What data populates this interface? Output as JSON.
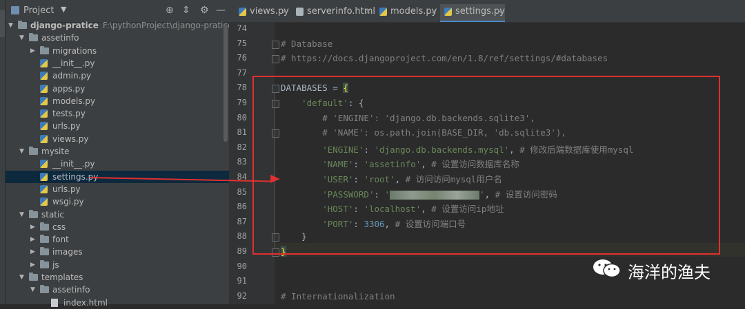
{
  "project_panel": {
    "title": "Project",
    "tree": [
      {
        "label": "django-pratice",
        "path": "F:\\pythonProject\\django-pratice",
        "kind": "folder",
        "level": 0,
        "open": true
      },
      {
        "label": "assetinfo",
        "kind": "folder",
        "level": 1,
        "open": true
      },
      {
        "label": "migrations",
        "kind": "folder",
        "level": 2,
        "open": false
      },
      {
        "label": "__init__.py",
        "kind": "py",
        "level": 2
      },
      {
        "label": "admin.py",
        "kind": "py",
        "level": 2
      },
      {
        "label": "apps.py",
        "kind": "py",
        "level": 2
      },
      {
        "label": "models.py",
        "kind": "py",
        "level": 2
      },
      {
        "label": "tests.py",
        "kind": "py",
        "level": 2
      },
      {
        "label": "urls.py",
        "kind": "py",
        "level": 2
      },
      {
        "label": "views.py",
        "kind": "py",
        "level": 2
      },
      {
        "label": "mysite",
        "kind": "folder",
        "level": 1,
        "open": true
      },
      {
        "label": "__init__.py",
        "kind": "py",
        "level": 2
      },
      {
        "label": "settings.py",
        "kind": "py",
        "level": 2,
        "selected": true
      },
      {
        "label": "urls.py",
        "kind": "py",
        "level": 2
      },
      {
        "label": "wsgi.py",
        "kind": "py",
        "level": 2
      },
      {
        "label": "static",
        "kind": "folder",
        "level": 1,
        "open": true
      },
      {
        "label": "css",
        "kind": "folder",
        "level": 2,
        "open": false
      },
      {
        "label": "font",
        "kind": "folder",
        "level": 2,
        "open": false
      },
      {
        "label": "images",
        "kind": "folder",
        "level": 2,
        "open": false
      },
      {
        "label": "js",
        "kind": "folder",
        "level": 2,
        "open": false
      },
      {
        "label": "templates",
        "kind": "folder",
        "level": 1,
        "open": true
      },
      {
        "label": "assetinfo",
        "kind": "folder",
        "level": 2,
        "open": true
      },
      {
        "label": "index.html",
        "kind": "html",
        "level": 3
      }
    ]
  },
  "tabs": [
    {
      "label": "views.py",
      "kind": "py",
      "active": false
    },
    {
      "label": "serverinfo.html",
      "kind": "html",
      "active": false
    },
    {
      "label": "models.py",
      "kind": "py",
      "active": false
    },
    {
      "label": "settings.py",
      "kind": "py",
      "active": true
    }
  ],
  "editor": {
    "lines": [
      {
        "n": "74",
        "html": ""
      },
      {
        "n": "75",
        "html": "<span class='cmt'># Database</span>"
      },
      {
        "n": "76",
        "html": "<span class='cmt'># https://docs.djangoproject.com/en/1.8/ref/settings/#databases</span>"
      },
      {
        "n": "77",
        "html": ""
      },
      {
        "n": "78",
        "html": "DATABASES = <span class='brace-hl'>{</span>"
      },
      {
        "n": "79",
        "html": "    <span class='str'>'default'</span>: {"
      },
      {
        "n": "80",
        "html": "        <span class='cmt'># 'ENGINE': 'django.db.backends.sqlite3',</span>"
      },
      {
        "n": "81",
        "html": "        <span class='cmt'># 'NAME': os.path.join(BASE_DIR, 'db.sqlite3'),</span>"
      },
      {
        "n": "82",
        "html": "        <span class='str'>'ENGINE'</span>: <span class='str'>'django.db.backends.mysql'</span>, <span class='ucmt'># 修改后端数据库使用mysql</span>"
      },
      {
        "n": "83",
        "html": "        <span class='str'>'NAME'</span>: <span class='str'>'assetinfo'</span>, <span class='ucmt'># 设置访问数据库名称</span>"
      },
      {
        "n": "84",
        "html": "        <span class='str'>'USER'</span>: <span class='str'>'root'</span>, <span class='ucmt'># 访问访问mysql用户名</span>"
      },
      {
        "n": "85",
        "html": "        <span class='str'>'PASSWORD'</span>: <span class='str'>'</span><span class='blur'></span><span class='str'>'</span>, <span class='ucmt'># 设置访问密码</span>"
      },
      {
        "n": "86",
        "html": "        <span class='str'>'HOST'</span>: <span class='str'>'localhost'</span>, <span class='ucmt'># 设置访问ip地址</span>"
      },
      {
        "n": "87",
        "html": "        <span class='str'>'PORT'</span>: <span class='num'>3306</span>, <span class='ucmt'># 设置访问端口号</span>"
      },
      {
        "n": "88",
        "html": "    }"
      },
      {
        "n": "89",
        "html": "<span class='brace-hl'>}</span>"
      },
      {
        "n": "90",
        "html": ""
      },
      {
        "n": "91",
        "html": ""
      },
      {
        "n": "92",
        "html": "<span class='cmt'># Internationalization</span>"
      }
    ]
  },
  "watermark": {
    "text": "海洋的渔夫"
  }
}
